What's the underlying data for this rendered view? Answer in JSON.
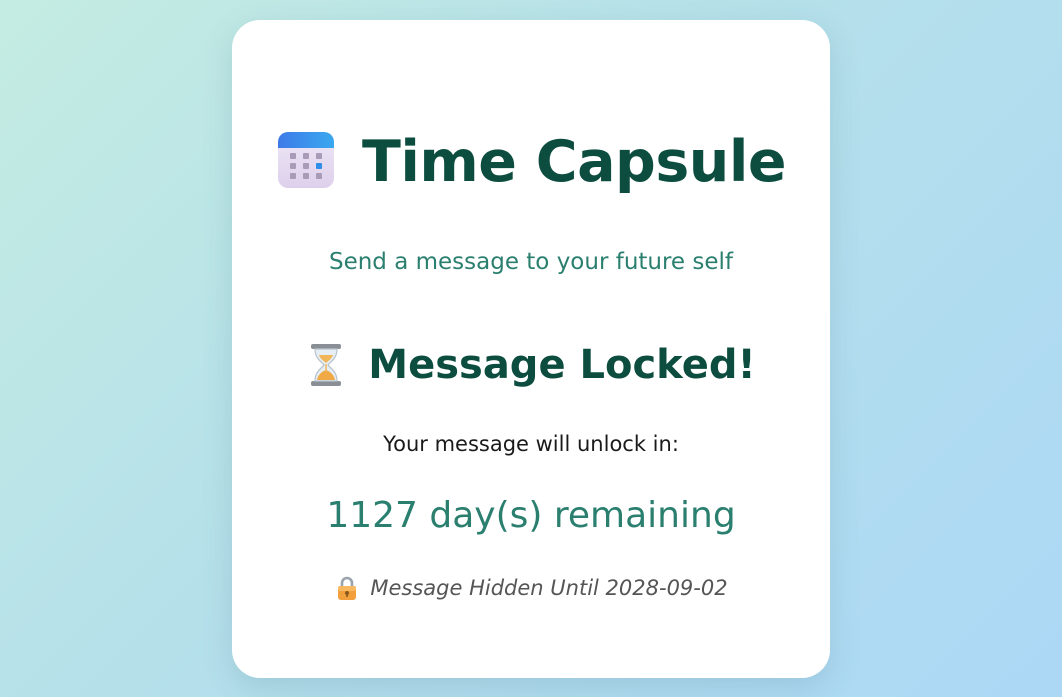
{
  "app": {
    "title": "Time Capsule",
    "subtitle": "Send a message to your future self",
    "title_icon": "calendar-icon"
  },
  "status": {
    "icon": "hourglass-icon",
    "heading": "Message Locked!",
    "unlock_label": "Your message will unlock in:",
    "remaining_text": "1127 day(s) remaining",
    "lock_icon": "lock-icon",
    "hidden_text": "Message Hidden Until 2028-09-02"
  },
  "colors": {
    "background_start": "#c4ece2",
    "background_end": "#acd8f6",
    "card": "#ffffff",
    "heading": "#0d4d3f",
    "accent": "#2a7f6f",
    "muted": "#555555"
  }
}
